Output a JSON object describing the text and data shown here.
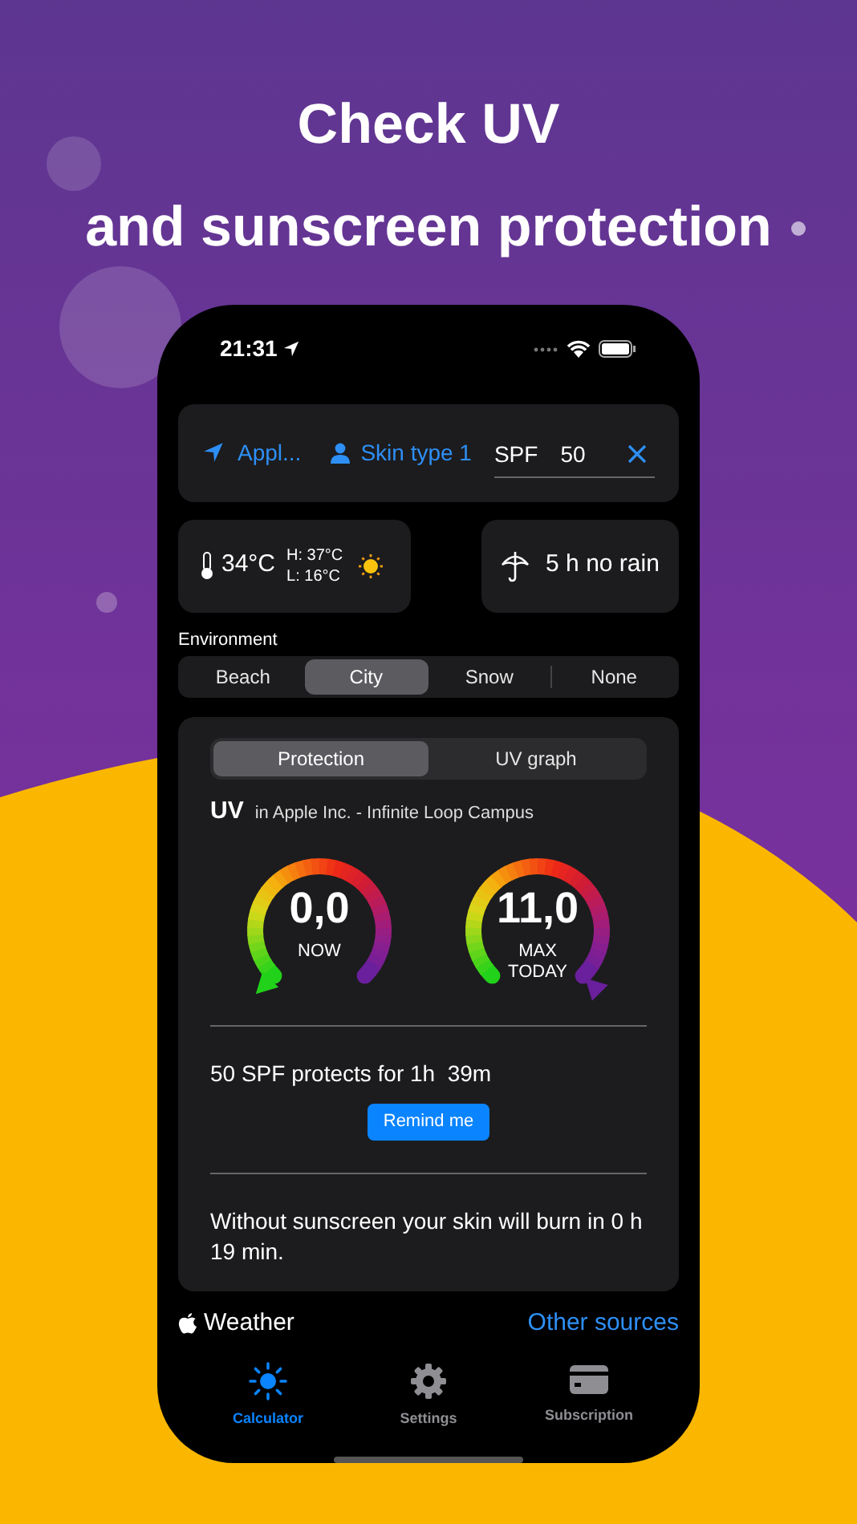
{
  "headline": [
    "Check UV",
    "and sunscreen protection"
  ],
  "status_bar": {
    "time": "21:31"
  },
  "top_card": {
    "location": "Appl...",
    "skin_type": "Skin type 1",
    "spf_label": "SPF",
    "spf_value": "50"
  },
  "weather": {
    "temperature": "34°C",
    "high": "H: 37°C",
    "low": "L: 16°C",
    "rain": "5 h no rain"
  },
  "environment": {
    "label": "Environment",
    "options": [
      {
        "label": "Beach",
        "selected": false
      },
      {
        "label": "City",
        "selected": true
      },
      {
        "label": "Snow",
        "selected": false
      },
      {
        "label": "None",
        "selected": false
      }
    ]
  },
  "panel": {
    "tabs": [
      {
        "label": "Protection",
        "selected": true
      },
      {
        "label": "UV graph",
        "selected": false
      }
    ],
    "uv_title": "UV",
    "uv_location": "in Apple Inc. - Infinite Loop Campus",
    "gauges": [
      {
        "value": "0,0",
        "caption": [
          "NOW"
        ],
        "pointer_at_end": false
      },
      {
        "value": "11,0",
        "caption": [
          "MAX",
          "TODAY"
        ],
        "pointer_at_end": true
      }
    ],
    "protection_text": "50 SPF protects for 1h  39m",
    "remind_button": "Remind me",
    "burn_text": "Without sunscreen your skin will burn in 0 h 19 min."
  },
  "source": {
    "name": "Weather",
    "link": "Other sources"
  },
  "tab_bar": [
    {
      "kind": "sun",
      "label": "Calculator",
      "selected": true
    },
    {
      "kind": "gear",
      "label": "Settings",
      "selected": false
    },
    {
      "kind": "card",
      "label": "Subscription",
      "selected": false
    }
  ]
}
